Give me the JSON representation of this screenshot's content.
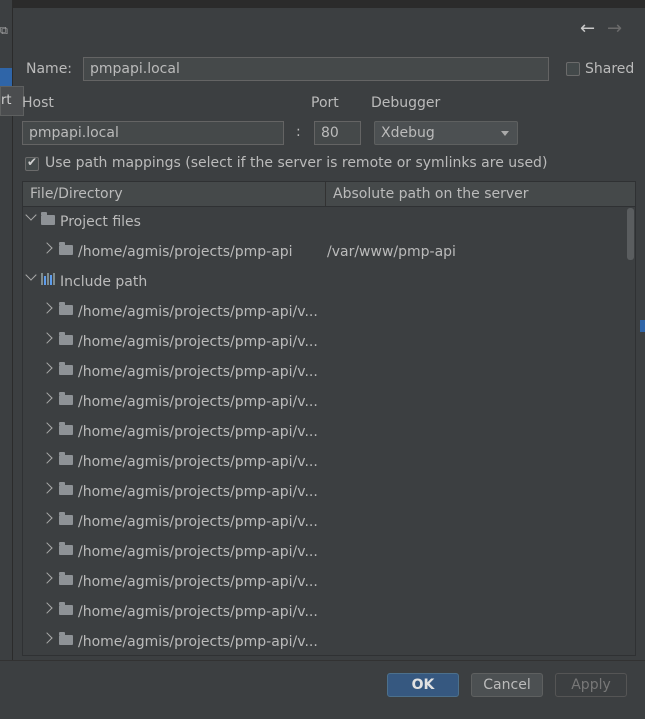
{
  "window": {
    "tooltip_text": "rt",
    "corner_icon": "window-icon",
    "nav_back_icon": "arrow-left-icon",
    "nav_forward_icon": "arrow-right-icon"
  },
  "form": {
    "name_label": "Name:",
    "name_value": "pmpapi.local",
    "shared_label": "Shared",
    "shared_checked": false,
    "host_label": "Host",
    "host_value": "pmpapi.local",
    "colon": ":",
    "port_label": "Port",
    "port_value": "80",
    "debugger_label": "Debugger",
    "debugger_value": "Xdebug",
    "path_mappings_label": "Use path mappings (select if the server is remote or symlinks are used)",
    "path_mappings_checked": true
  },
  "table": {
    "columns": [
      "File/Directory",
      "Absolute path on the server"
    ],
    "project_group": {
      "label": "Project files",
      "expanded": true
    },
    "project_rows": [
      {
        "path": "/home/agmis/projects/pmp-api",
        "server_path": "/var/www/pmp-api"
      }
    ],
    "include_group": {
      "label": "Include path",
      "expanded": true
    },
    "include_rows": [
      {
        "path": "/home/agmis/projects/pmp-api/v..."
      },
      {
        "path": "/home/agmis/projects/pmp-api/v..."
      },
      {
        "path": "/home/agmis/projects/pmp-api/v..."
      },
      {
        "path": "/home/agmis/projects/pmp-api/v..."
      },
      {
        "path": "/home/agmis/projects/pmp-api/v..."
      },
      {
        "path": "/home/agmis/projects/pmp-api/v..."
      },
      {
        "path": "/home/agmis/projects/pmp-api/v..."
      },
      {
        "path": "/home/agmis/projects/pmp-api/v..."
      },
      {
        "path": "/home/agmis/projects/pmp-api/v..."
      },
      {
        "path": "/home/agmis/projects/pmp-api/v..."
      },
      {
        "path": "/home/agmis/projects/pmp-api/v..."
      },
      {
        "path": "/home/agmis/projects/pmp-api/v..."
      }
    ]
  },
  "buttons": {
    "ok": "OK",
    "cancel": "Cancel",
    "apply": "Apply"
  },
  "colors": {
    "background": "#3c3f41",
    "primary_button": "#365880",
    "accent_blue": "#2f65a8"
  }
}
